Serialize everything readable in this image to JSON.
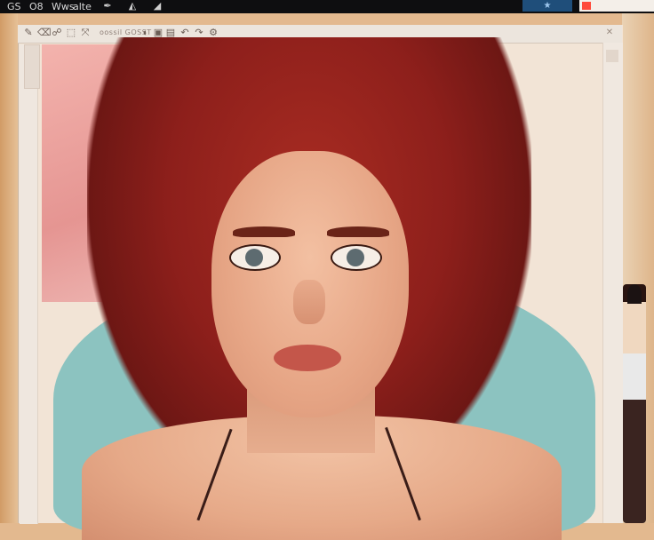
{
  "top_bar": {
    "label_1": "GS",
    "label_2": "O8",
    "label_3": "Wws",
    "label_4": "alte",
    "icons": [
      "pen-tool-icon",
      "layers-icon",
      "adjust-icon"
    ],
    "blue_button_icon": "star-icon"
  },
  "toolbar": {
    "brand_text": "oossil GOSST",
    "tools": [
      "brush-icon",
      "eraser-icon",
      "smudge-icon",
      "select-icon",
      "transform-icon",
      "color-icon",
      "fill-icon",
      "ruler-icon",
      "undo-icon",
      "redo-icon"
    ],
    "close_icon": "close-icon"
  },
  "colors": {
    "hair": "#8d1f1b",
    "background_pink": "#e59592",
    "background_teal": "#8cc3c0",
    "blue_button": "#1f4e7a",
    "red_indicator": "#ff4a3a"
  }
}
